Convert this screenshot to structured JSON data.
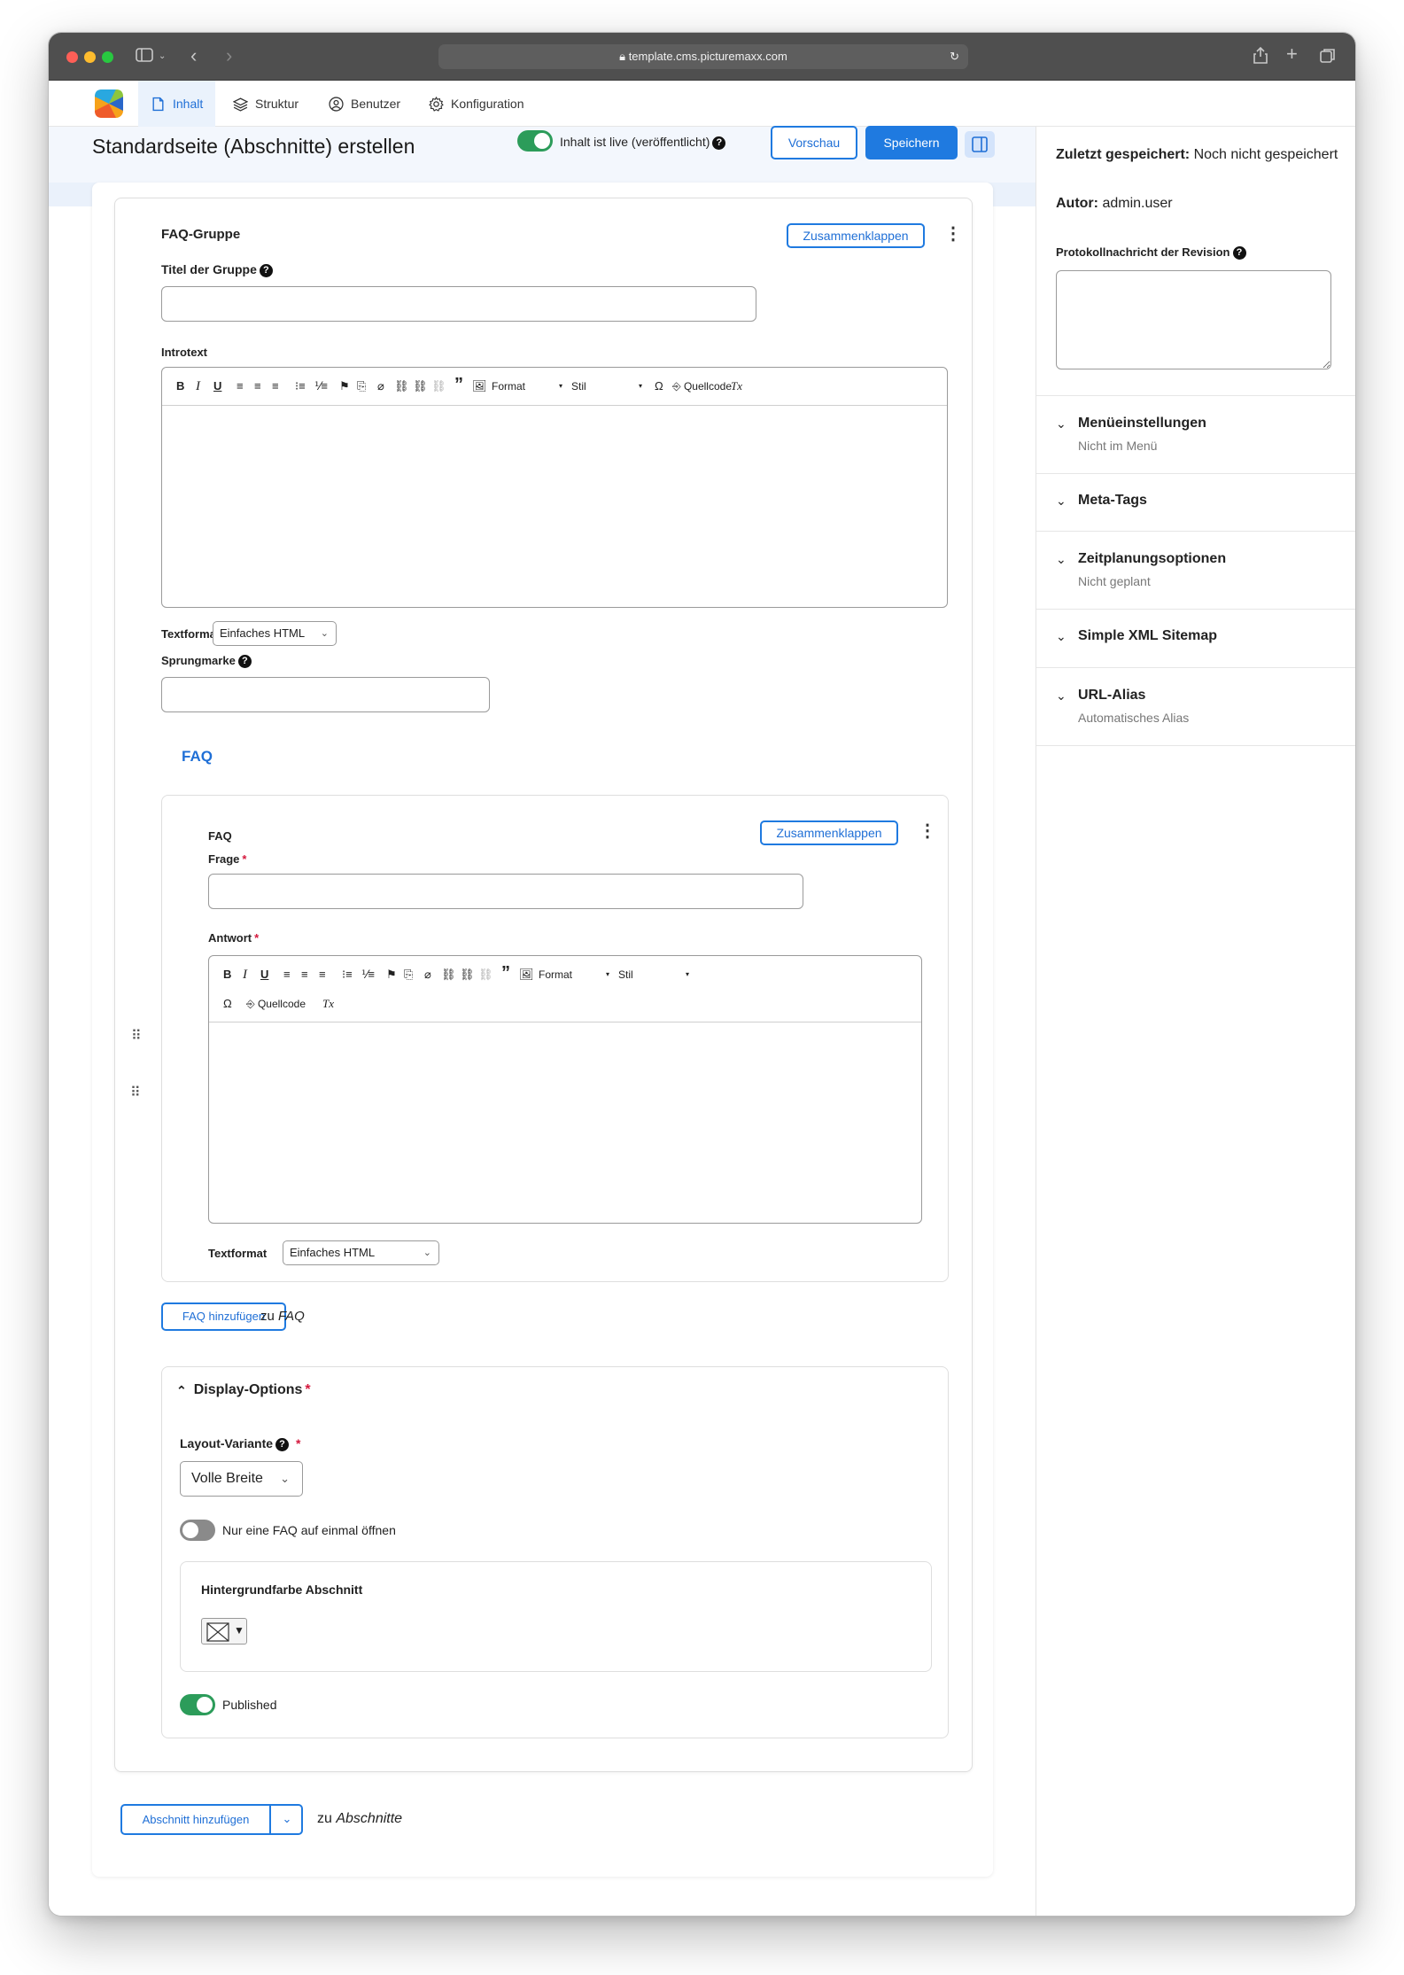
{
  "browser": {
    "url": "template.cms.picturemaxx.com"
  },
  "nav": {
    "items": [
      {
        "label": "Inhalt"
      },
      {
        "label": "Struktur"
      },
      {
        "label": "Benutzer"
      },
      {
        "label": "Konfiguration"
      }
    ]
  },
  "header": {
    "title": "Standardseite (Abschnitte) erstellen",
    "live_label": "Inhalt ist live (veröffentlicht)",
    "preview_label": "Vorschau",
    "save_label": "Speichern"
  },
  "faq_group": {
    "heading": "FAQ-Gruppe",
    "collapse_label": "Zusammenklappen",
    "group_title_label": "Titel der Gruppe",
    "group_title_value": "",
    "introtext_label": "Introtext",
    "textformat_label": "Textformat",
    "textformat_value": "Einfaches HTML",
    "anchor_label": "Sprungmarke",
    "anchor_value": ""
  },
  "toolbar": {
    "bold": "B",
    "italic": "I",
    "underline": "U",
    "quote": "”",
    "format": "Format",
    "style": "Stil",
    "omega": "Ω",
    "source": "Quellcode",
    "clear": "Tx"
  },
  "faq_section": {
    "title": "FAQ",
    "item_heading": "FAQ",
    "collapse_label": "Zusammenklappen",
    "question_label": "Frage",
    "answer_label": "Antwort",
    "textformat_label": "Textformat",
    "textformat_value": "Einfaches HTML",
    "add_button": "FAQ hinzufügen",
    "add_to_prefix": "zu",
    "add_to_target": "FAQ"
  },
  "display_options": {
    "title": "Display-Options",
    "layout_label": "Layout-Variante",
    "layout_value": "Volle Breite",
    "single_faq_label": "Nur eine FAQ auf einmal öffnen",
    "single_faq_on": false,
    "bg_color_label": "Hintergrundfarbe Abschnitt",
    "published_label": "Published",
    "published_on": true
  },
  "sections": {
    "add_button": "Abschnitt hinzufügen",
    "add_to_prefix": "zu",
    "add_to_target": "Abschnitte"
  },
  "sidebar": {
    "last_saved_label": "Zuletzt gespeichert:",
    "last_saved_value": "Noch nicht gespeichert",
    "author_label": "Autor:",
    "author_value": "admin.user",
    "revision_label": "Protokollnachricht der Revision",
    "revision_value": "",
    "sections": [
      {
        "title": "Menüeinstellungen",
        "subtitle": "Nicht im Menü"
      },
      {
        "title": "Meta-Tags",
        "subtitle": ""
      },
      {
        "title": "Zeitplanungsoptionen",
        "subtitle": "Nicht geplant"
      },
      {
        "title": "Simple XML Sitemap",
        "subtitle": ""
      },
      {
        "title": "URL-Alias",
        "subtitle": "Automatisches Alias"
      }
    ]
  },
  "colors": {
    "accent": "#1f7ae0",
    "toggle_on": "#2c9c5a",
    "toggle_off": "#8a8a8a"
  }
}
